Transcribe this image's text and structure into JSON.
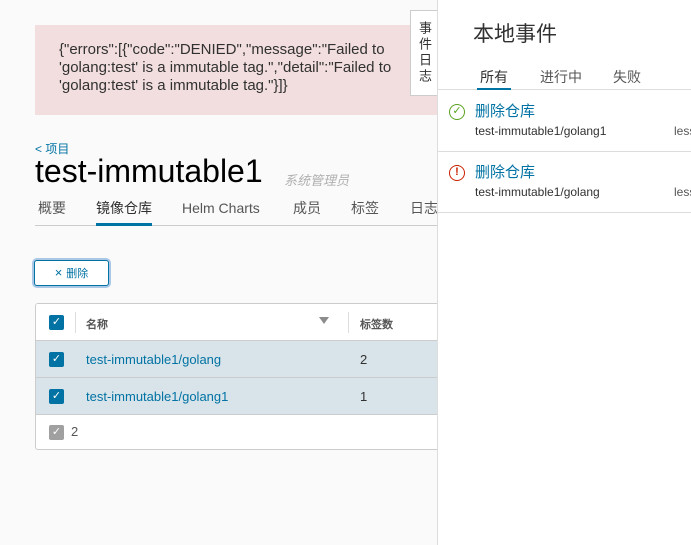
{
  "alert": {
    "lines": [
      "{\"errors\":[{\"code\":\"DENIED\",\"message\":\"Failed to",
      "'golang:test' is a immutable tag.\",\"detail\":\"Failed to",
      "'golang:test' is a immutable tag.\"}]}"
    ]
  },
  "breadcrumb": "< 项目",
  "project": {
    "title": "test-immutable1",
    "role": "系统管理员"
  },
  "tabs": [
    "概要",
    "镜像仓库",
    "Helm Charts",
    "成员",
    "标签",
    "日志"
  ],
  "toolbar": {
    "delete_label": "删除",
    "delete_icon": "×"
  },
  "grid": {
    "columns": [
      "名称",
      "标签数"
    ],
    "rows": [
      {
        "name": "test-immutable1/golang",
        "count": "2"
      },
      {
        "name": "test-immutable1/golang1",
        "count": "1"
      }
    ],
    "footer_count": "2"
  },
  "panel": {
    "tab_label": "事件日志",
    "title": "本地事件",
    "tabs": [
      "所有",
      "进行中",
      "失败"
    ],
    "events": [
      {
        "title": "删除仓库",
        "path": "test-immutable1/golang1",
        "time": "less",
        "status": "success"
      },
      {
        "title": "删除仓库",
        "path": "test-immutable1/golang",
        "time": "less",
        "status": "error"
      }
    ]
  },
  "colors": {
    "accent": "#0072a3",
    "alert_bg": "#f2dede",
    "success": "#5aa220",
    "error": "#c92100"
  }
}
